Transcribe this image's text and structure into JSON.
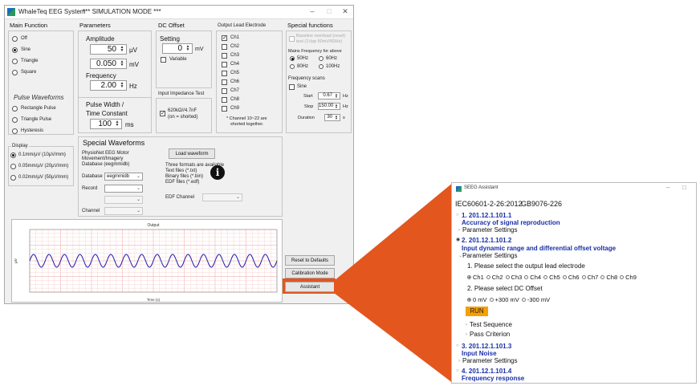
{
  "main_window": {
    "title": "WhaleTeq EEG System",
    "mode": "*** SIMULATION MODE ***",
    "controls": {
      "minimize": "–",
      "maximize": "□",
      "close": "✕"
    }
  },
  "main_function": {
    "title": "Main Function",
    "options": [
      "Off",
      "Sine",
      "Triangle",
      "Square"
    ],
    "selected": "Sine"
  },
  "pulse_waveforms": {
    "title": "Pulse Waveforms",
    "options": [
      "Rectangle Pulse",
      "Triangle Pulse",
      "Hysteresis"
    ]
  },
  "display": {
    "title": "Display",
    "options": [
      "0.1mm/µV (10µV/mm)",
      "0.05mm/µV (20µV/mm)",
      "0.02mm/µV (50µV/mm)"
    ]
  },
  "parameters": {
    "title": "Parameters",
    "amplitude_label": "Amplitude",
    "amp_uv": "50",
    "amp_uv_unit": "µV",
    "amp_mv": "0.050",
    "amp_mv_unit": "mV",
    "frequency_label": "Frequency",
    "freq": "2.00",
    "freq_unit": "Hz",
    "pulse_width_label_1": "Pulse Width /",
    "pulse_width_label_2": "Time Constant",
    "pulse_width": "100",
    "pulse_width_unit": "ms"
  },
  "dc_offset": {
    "title": "DC Offset",
    "setting_label": "Setting",
    "value": "0",
    "unit": "mV",
    "variable_label": "Variable"
  },
  "impedance": {
    "title": "Input Impedance Test",
    "label_1": "620kΩ//4.7nF",
    "label_2": "(on = shorted)"
  },
  "output_lead": {
    "title": "Output Lead Electrode",
    "channels": [
      "Ch1",
      "Ch2",
      "Ch3",
      "Ch4",
      "Ch5",
      "Ch6",
      "Ch7",
      "Ch8",
      "Ch9"
    ],
    "note_1": "* Channel 10~22 are",
    "note_2": "shorted together."
  },
  "special_functions": {
    "title": "Special functions",
    "baseline_1": "Baseline overload (reset)",
    "baseline_2": "test (1Vpp 50mV/60Hz)",
    "mains_label": "Mains Frequency for above",
    "mains_options": [
      "50Hz",
      "60Hz",
      "80Hz",
      "100Hz"
    ],
    "freq_scans_label": "Frequency scans",
    "sine_label": "Sine",
    "start_label": "Start",
    "start_value": "0.67",
    "stop_label": "Stop",
    "stop_value": "150.00",
    "hz": "Hz",
    "duration_label": "Duration",
    "duration_value": "30",
    "duration_unit": "s"
  },
  "special_waveforms": {
    "title": "Special Waveforms",
    "db_desc_1": "PhysioNet EEG Motor",
    "db_desc_2": "Movement/Imagery",
    "db_desc_3": "Database (eegmmidb)",
    "database_label": "Database",
    "database_value": "eegmmidb",
    "record_label": "Record",
    "channel_label": "Channel",
    "load_button": "Load waveform",
    "formats_1": "Three formats are available",
    "formats_2": "Text files (*.txt)",
    "formats_3": "Binary files (*.bin)",
    "formats_4": "EDF files (*.edf)",
    "edf_channel_label": "EDF Channel"
  },
  "plot": {
    "title": "Output",
    "xlabel": "Time (s)",
    "ylabel": "µV"
  },
  "buttons": {
    "reset": "Reset to Defaults",
    "calibration": "Calibration Mode",
    "assistant": "Assistant"
  },
  "assistant_window": {
    "title": "SEEG Assistant",
    "standard_1": "IEC60601-2-26:2012",
    "standard_2": "GB9076-226",
    "item1_num": "1. 201.12.1.101.1",
    "item1_title": "Accuracy of signal reproduction",
    "param_settings": "Parameter Settings",
    "item2_num": "2. 201.12.1.101.2",
    "item2_title": "Input dynamic range and differential offset voltage",
    "q1": "1. Please select the output lead electrode",
    "channels": [
      "Ch1",
      "Ch2",
      "Ch3",
      "Ch4",
      "Ch5",
      "Ch6",
      "Ch7",
      "Ch8",
      "Ch9"
    ],
    "q2": "2. Please select DC Offset",
    "offsets": [
      "0 mV",
      "+300 mV",
      "-300 mV"
    ],
    "run": "RUN",
    "test_sequence": "Test Sequence",
    "pass_criterion": "Pass Criterion",
    "item3_num": "3. 201.12.1.101.3",
    "item3_title": "Input Noise",
    "item4_num": "4. 201.12.1.101.4",
    "item4_title": "Frequency response"
  },
  "colors": {
    "callout": "#e3561e",
    "link_blue": "#1a2fa8",
    "run": "#f5a000",
    "wave": "#1a1aaa"
  }
}
